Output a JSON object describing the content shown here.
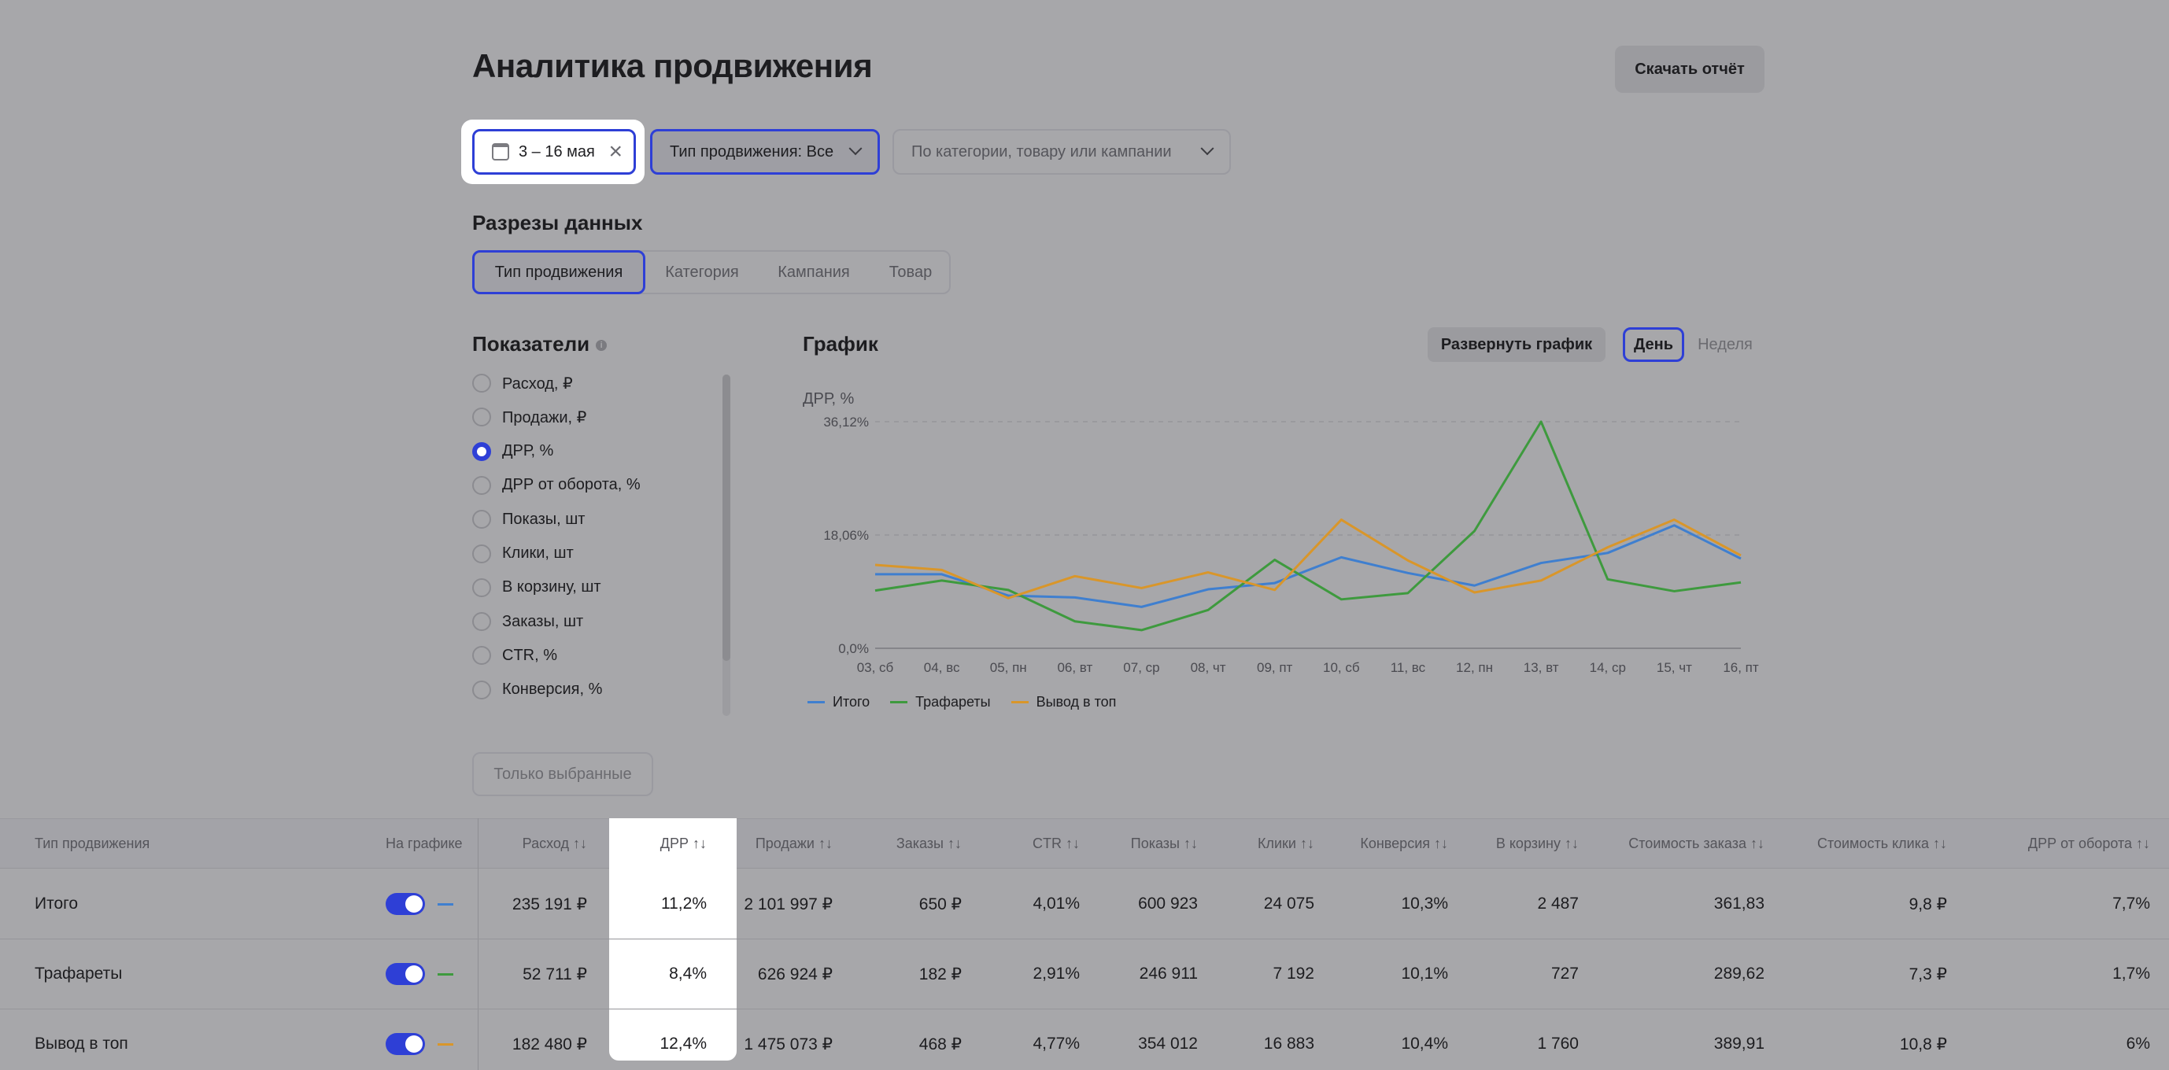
{
  "page": {
    "title": "Аналитика продвижения",
    "download_label": "Скачать отчёт"
  },
  "filters": {
    "date_range": "3 – 16 мая",
    "promo_type": "Тип продвижения: Все",
    "search_placeholder": "По категории, товару или кампании"
  },
  "slices": {
    "title": "Разрезы данных",
    "tabs": [
      "Тип продвижения",
      "Категория",
      "Кампания",
      "Товар"
    ],
    "active": "Тип продвижения"
  },
  "metrics": {
    "title": "Показатели",
    "items": [
      "Расход, ₽",
      "Продажи, ₽",
      "ДРР, %",
      "ДРР от оборота, %",
      "Показы, шт",
      "Клики, шт",
      "В корзину, шт",
      "Заказы, шт",
      "CTR, %",
      "Конверсия, %"
    ],
    "selected": "ДРР, %",
    "only_selected_label": "Только выбранные"
  },
  "chart_panel": {
    "title": "График",
    "expand_label": "Развернуть график",
    "period_day": "День",
    "period_week": "Неделя",
    "active_period": "День"
  },
  "chart_data": {
    "type": "line",
    "ylabel": "ДРР, %",
    "ylim": [
      0,
      36.12
    ],
    "ytick_labels": [
      "36,12%",
      "18,06%",
      "0,0%"
    ],
    "yticks": [
      36.12,
      18.06,
      0
    ],
    "categories": [
      "03, сб",
      "04, вс",
      "05, пн",
      "06, вт",
      "07, ср",
      "08, чт",
      "09, пт",
      "10, сб",
      "11, вс",
      "12, пн",
      "13, вт",
      "14, ср",
      "15, чт",
      "16, пт"
    ],
    "series": [
      {
        "name": "Итого",
        "color": "#3f7fcf",
        "values": [
          11.8,
          11.8,
          8.4,
          8.1,
          6.6,
          9.4,
          10.4,
          14.5,
          12.0,
          10.0,
          13.6,
          15.2,
          19.6,
          14.3
        ]
      },
      {
        "name": "Трафареты",
        "color": "#3e9a3e",
        "values": [
          9.2,
          10.8,
          9.3,
          4.3,
          2.9,
          6.1,
          14.1,
          7.8,
          8.8,
          18.7,
          36.12,
          11.0,
          9.1,
          10.5
        ]
      },
      {
        "name": "Вывод в топ",
        "color": "#d9962a",
        "values": [
          13.3,
          12.5,
          8.0,
          11.5,
          9.6,
          12.1,
          9.3,
          20.5,
          14.0,
          8.9,
          10.8,
          16.1,
          20.5,
          14.8
        ]
      }
    ],
    "grid": "dashed-horizontal",
    "legend_position": "bottom-left"
  },
  "table": {
    "headers": {
      "type": "Тип продвижения",
      "on_chart": "На графике",
      "cols": [
        "Расход ↑↓",
        "ДРР ↑↓",
        "Продажи ↑↓",
        "Заказы ↑↓",
        "CTR ↑↓",
        "Показы ↑↓",
        "Клики ↑↓",
        "Конверсия ↑↓",
        "В корзину ↑↓",
        "Стоимость заказа ↑↓",
        "Стоимость клика ↑↓",
        "ДРР от оборота ↑↓"
      ]
    },
    "rows": [
      {
        "name": "Итого",
        "color": "#3f7fcf",
        "cells": [
          "235 191 ₽",
          "11,2%",
          "2 101 997 ₽",
          "650 ₽",
          "4,01%",
          "600 923",
          "24 075",
          "10,3%",
          "2 487",
          "361,83",
          "9,8 ₽",
          "7,7%"
        ]
      },
      {
        "name": "Трафареты",
        "color": "#3e9a3e",
        "cells": [
          "52 711 ₽",
          "8,4%",
          "626 924 ₽",
          "182 ₽",
          "2,91%",
          "246 911",
          "7 192",
          "10,1%",
          "727",
          "289,62",
          "7,3 ₽",
          "1,7%"
        ]
      },
      {
        "name": "Вывод в топ",
        "color": "#d9962a",
        "cells": [
          "182 480 ₽",
          "12,4%",
          "1 475 073 ₽",
          "468 ₽",
          "4,77%",
          "354 012",
          "16 883",
          "10,4%",
          "1 760",
          "389,91",
          "10,8 ₽",
          "6%"
        ]
      }
    ]
  }
}
